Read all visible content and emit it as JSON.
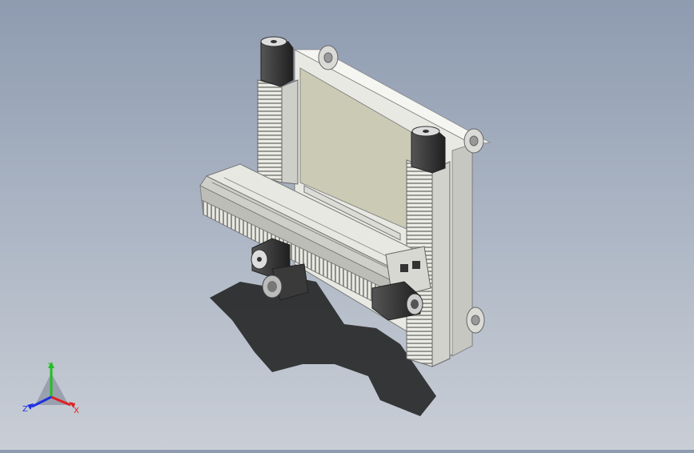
{
  "viewport": {
    "background_top": "#8e9bb0",
    "background_bottom": "#c9ced6"
  },
  "model": {
    "frame_color": "#dcdcd6",
    "panel_color": "#c9c8b3",
    "rail_color": "#d6d6d0",
    "motor_color": "#3a3a3a",
    "shadow_color": "#1a1a1a"
  },
  "triad": {
    "x_label": "X",
    "y_label": "Y",
    "z_label": "Z",
    "x_color": "#e02020",
    "y_color": "#20c020",
    "z_color": "#2030e0"
  }
}
